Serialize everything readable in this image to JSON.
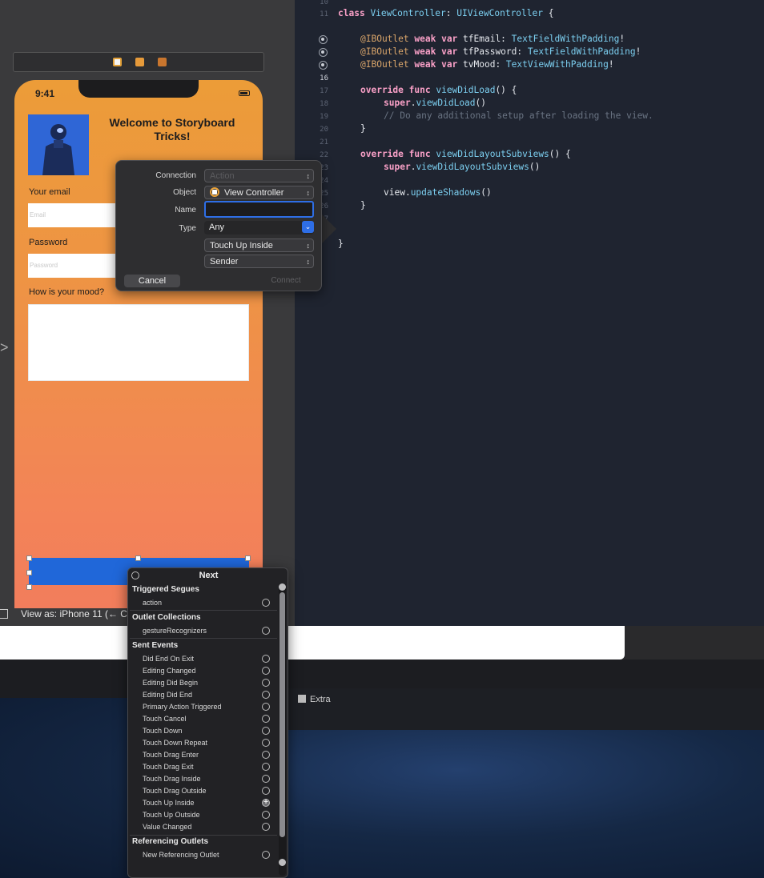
{
  "phone": {
    "time": "9:41",
    "welcome_title": "Welcome to Storyboard Tricks!",
    "email_label": "Your email",
    "email_placeholder": "Email",
    "password_label": "Password",
    "password_placeholder": "Password",
    "mood_label": "How is your mood?"
  },
  "canvas": {
    "view_as": "View as: iPhone 11 (← C"
  },
  "editor": {
    "line_numbers": [
      "10",
      "11",
      "",
      "",
      "",
      "16",
      "17",
      "18",
      "19",
      "20",
      "21",
      "22",
      "23",
      "24",
      "25",
      "26",
      "27",
      "28"
    ],
    "lines": {
      "l11": "class ViewController: UIViewController {",
      "o1": "@IBOutlet weak var tfEmail: TextFieldWithPadding!",
      "o2": "@IBOutlet weak var tfPassword: TextFieldWithPadding!",
      "o3": "@IBOutlet weak var tvMood: TextViewWithPadding!",
      "l17": "override func viewDidLoad() {",
      "l18": "super.viewDidLoad()",
      "l19": "// Do any additional setup after loading the view.",
      "l20": "}",
      "l22": "override func viewDidLayoutSubviews() {",
      "l23": "super.viewDidLayoutSubviews()",
      "l25": "view.updateShadows()",
      "l26": "}",
      "l28": "}"
    }
  },
  "popover": {
    "connection_label": "Connection",
    "connection_value": "Action",
    "object_label": "Object",
    "object_value": "View Controller",
    "name_label": "Name",
    "name_value": "",
    "type_label": "Type",
    "type_value": "Any",
    "event_value": "Touch Up Inside",
    "arguments_value": "Sender",
    "cancel": "Cancel",
    "connect": "Connect"
  },
  "hud": {
    "title": "Next",
    "sections": {
      "triggered_segues": "Triggered Segues",
      "outlet_collections": "Outlet Collections",
      "sent_events": "Sent Events",
      "referencing_outlets": "Referencing Outlets"
    },
    "segue_items": [
      "action"
    ],
    "collection_items": [
      "gestureRecognizers"
    ],
    "sent_events": [
      "Did End On Exit",
      "Editing Changed",
      "Editing Did Begin",
      "Editing Did End",
      "Primary Action Triggered",
      "Touch Cancel",
      "Touch Down",
      "Touch Down Repeat",
      "Touch Drag Enter",
      "Touch Drag Exit",
      "Touch Drag Inside",
      "Touch Drag Outside",
      "Touch Up Inside",
      "Touch Up Outside",
      "Value Changed"
    ],
    "referencing_items": [
      "New Referencing Outlet"
    ]
  },
  "bottom": {
    "extra": "Extra"
  },
  "colors": {
    "accent": "#2e6ee6",
    "editor_bg": "#1f2430",
    "keyword": "#f9a0c7",
    "type": "#7ccff0"
  }
}
